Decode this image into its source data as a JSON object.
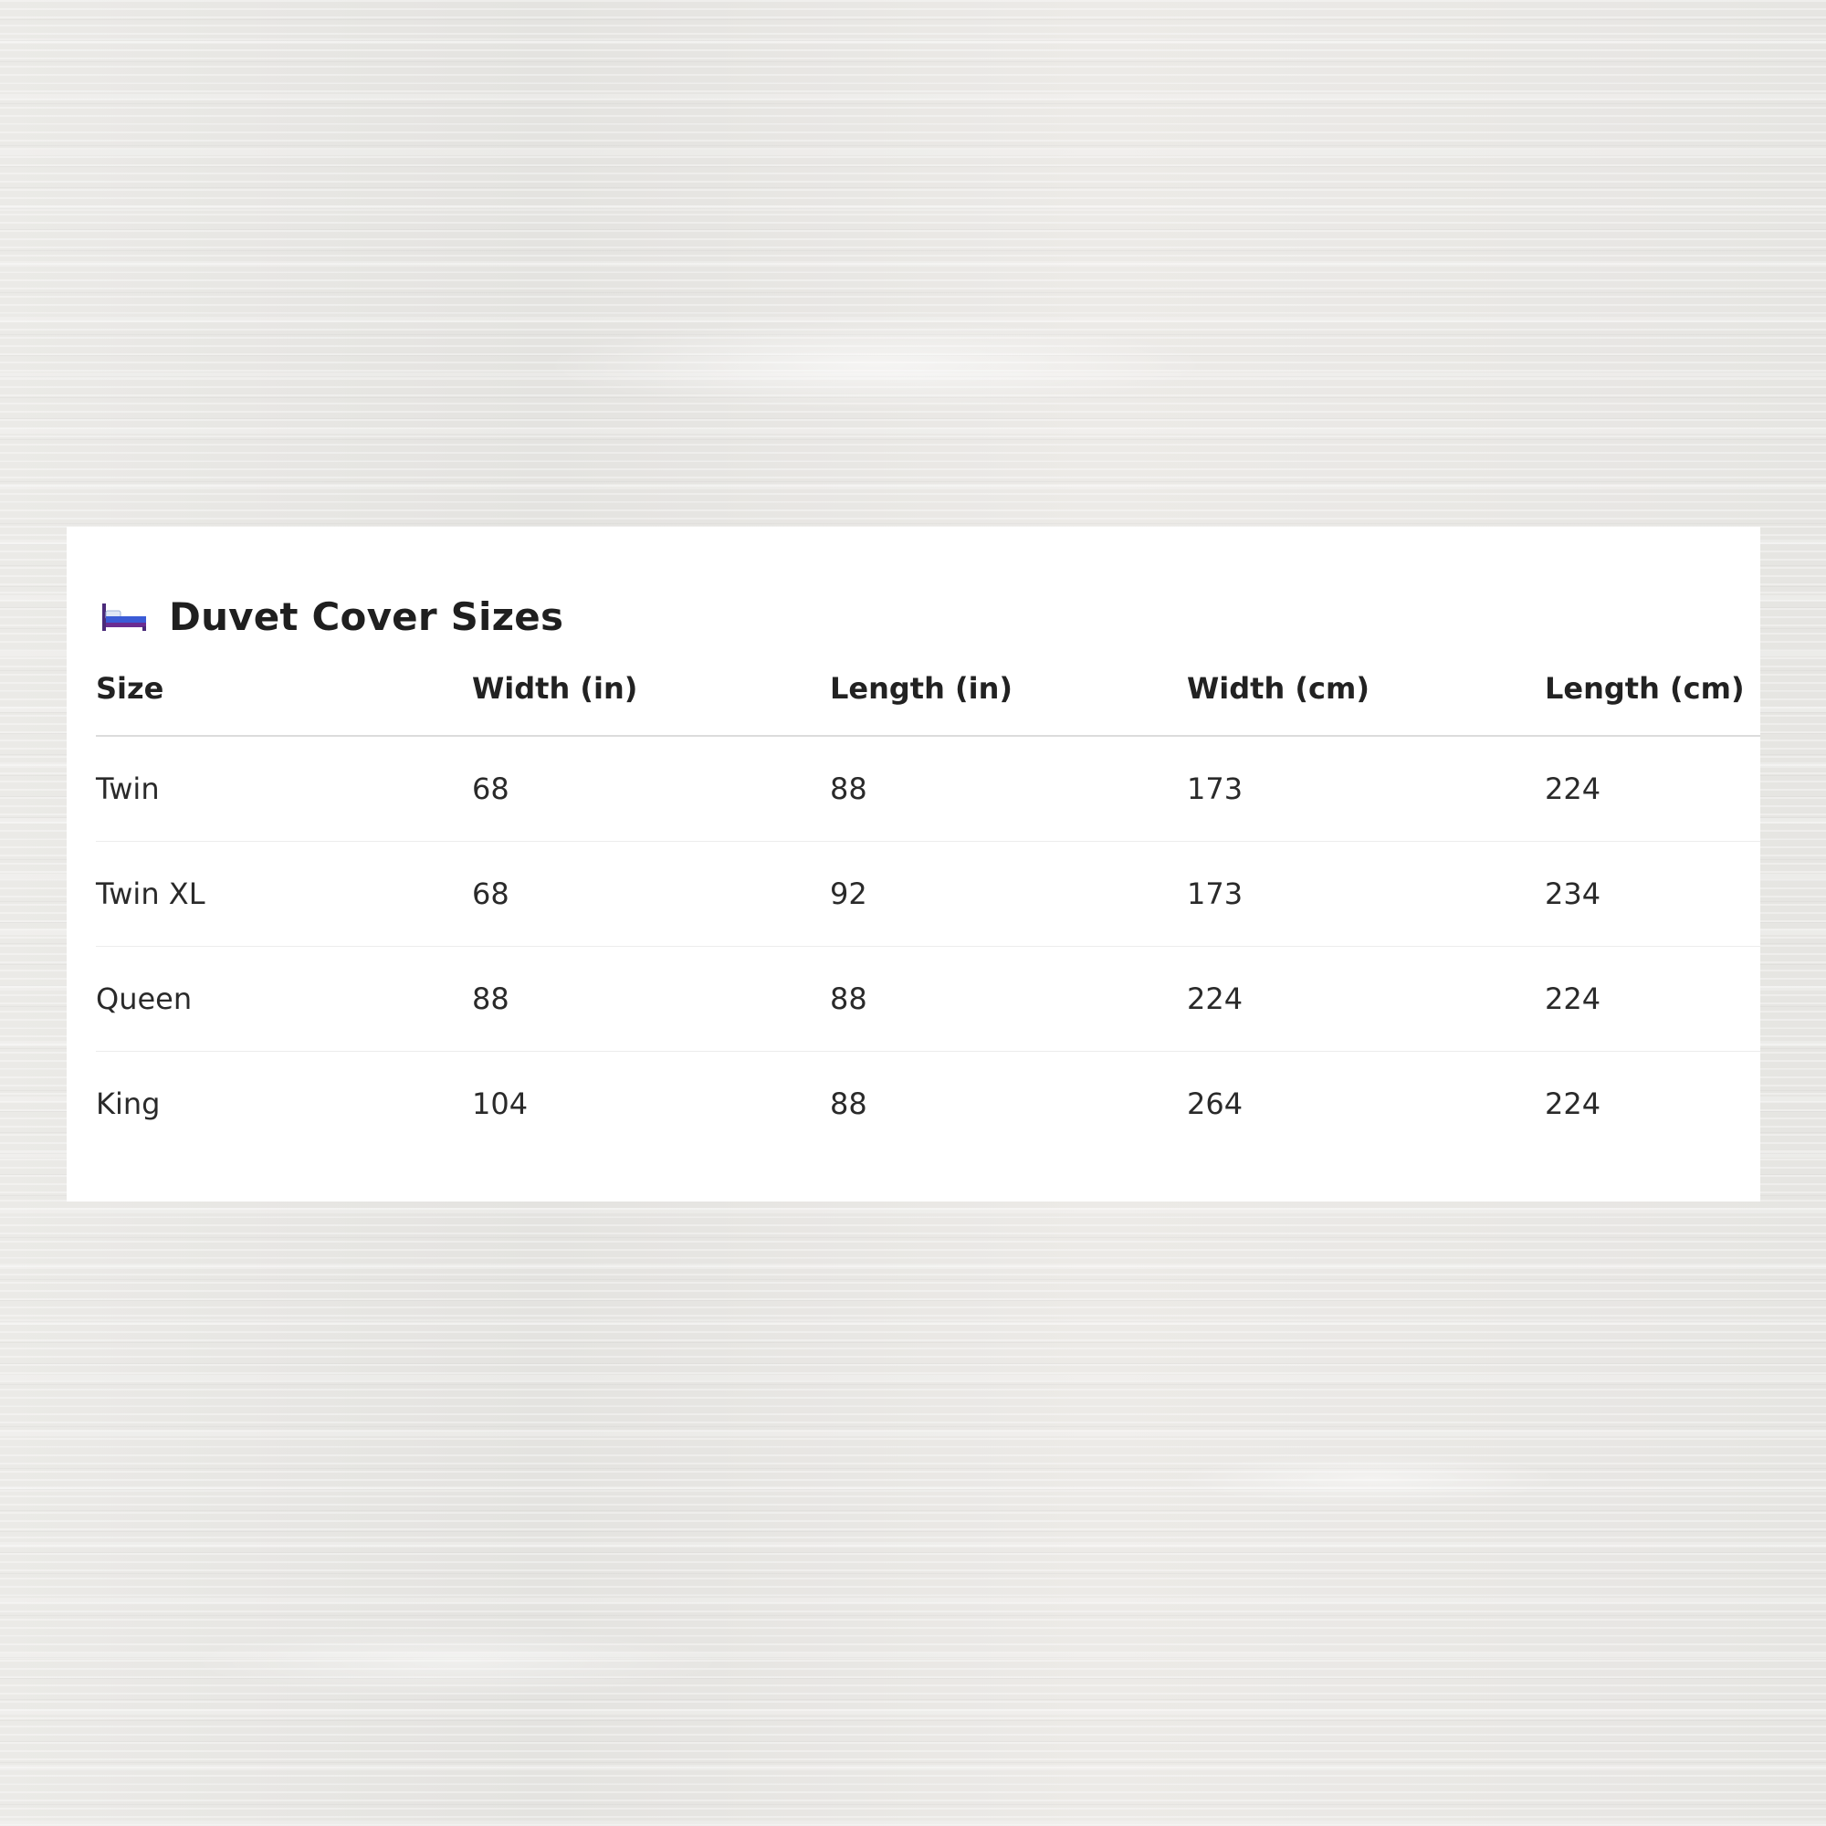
{
  "card": {
    "title": "Duvet Cover Sizes",
    "icon": "bed-icon"
  },
  "table": {
    "headers": [
      "Size",
      "Width (in)",
      "Length (in)",
      "Width (cm)",
      "Length (cm)"
    ],
    "rows": [
      [
        "Twin",
        "68",
        "88",
        "173",
        "224"
      ],
      [
        "Twin XL",
        "68",
        "92",
        "173",
        "234"
      ],
      [
        "Queen",
        "88",
        "88",
        "224",
        "224"
      ],
      [
        "King",
        "104",
        "88",
        "264",
        "224"
      ]
    ]
  },
  "colors": {
    "bed_blanket": "#3b5bd6",
    "bed_frame": "#6a2c91",
    "pillow": "#dfe6f5"
  }
}
